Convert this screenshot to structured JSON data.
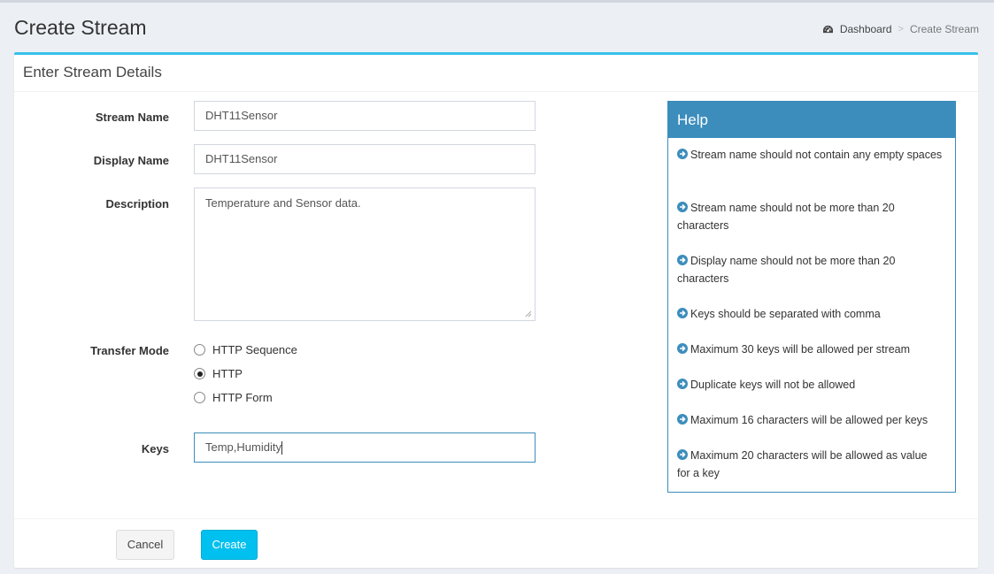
{
  "header": {
    "title": "Create Stream",
    "breadcrumb": {
      "home": "Dashboard",
      "separator": ">",
      "current": "Create Stream"
    }
  },
  "box": {
    "title": "Enter Stream Details"
  },
  "form": {
    "stream_name": {
      "label": "Stream Name",
      "value": "DHT11Sensor"
    },
    "display_name": {
      "label": "Display Name",
      "value": "DHT11Sensor"
    },
    "description": {
      "label": "Description",
      "value": "Temperature and Sensor data."
    },
    "transfer_mode": {
      "label": "Transfer Mode",
      "options": [
        "HTTP Sequence",
        "HTTP",
        "HTTP Form"
      ],
      "selected": "HTTP"
    },
    "keys": {
      "label": "Keys",
      "value": "Temp,Humidity"
    }
  },
  "help": {
    "title": "Help",
    "items": [
      "Stream name should not contain any empty spaces",
      "Stream name should not be more than 20 characters",
      "Display name should not be more than 20 characters",
      "Keys should be separated with comma",
      "Maximum 30 keys will be allowed per stream",
      "Duplicate keys will not be allowed",
      "Maximum 16 characters will be allowed per keys",
      "Maximum 20 characters will be allowed as value for a key"
    ]
  },
  "footer": {
    "cancel_label": "Cancel",
    "create_label": "Create"
  },
  "colors": {
    "accent": "#3ac0ea",
    "help_primary": "#3c8dbc",
    "create_button": "#00c0ef",
    "background": "#ecf0f5"
  },
  "icons": {
    "breadcrumb": "dashboard-icon",
    "help_bullet": "arrow-circle-right-icon"
  }
}
